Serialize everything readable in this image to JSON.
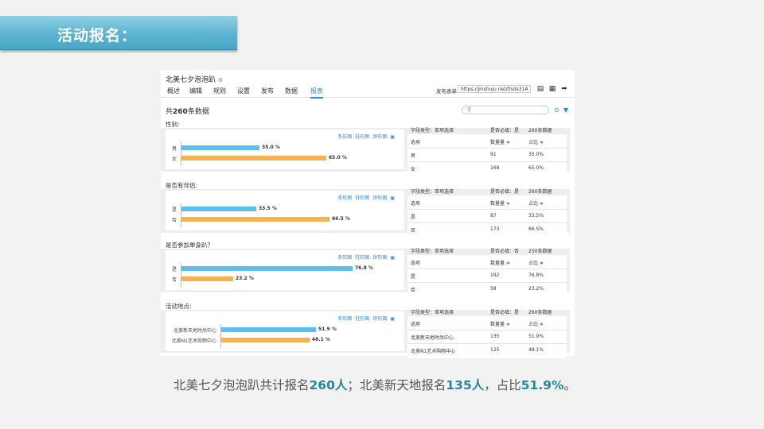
{
  "slide": {
    "banner_title": "活动报名：",
    "caption": [
      {
        "text": "北美七夕泡泡趴共计报名",
        "hl": false
      },
      {
        "text": "260人",
        "hl": true
      },
      {
        "text": "；北美新天地报名",
        "hl": false
      },
      {
        "text": "135人",
        "hl": true
      },
      {
        "text": "，占比",
        "hl": false
      },
      {
        "text": "51.9%",
        "hl": true
      },
      {
        "text": "。",
        "hl": false
      }
    ]
  },
  "app": {
    "title": "北美七夕泡泡趴",
    "tabs": [
      "概述",
      "编辑",
      "规则",
      "设置",
      "发布",
      "数据",
      "报表"
    ],
    "active_tab": "报表",
    "publish_label": "发布表单",
    "publish_url": "https://jinshuju.net/f/sds31A",
    "total_prefix": "共",
    "total_count": "260",
    "total_suffix": "条数据",
    "chart_links": [
      "条形图",
      "柱形图",
      "饼形图"
    ],
    "table_header": {
      "option": "选项",
      "count": "数量量 ≑",
      "ratio": "占比 ≑"
    },
    "accent_color": "#2a8bd8",
    "bar_colors": [
      "#5bc0ef",
      "#f7b150"
    ]
  },
  "sections": [
    {
      "title": "性别:",
      "field_type": "字段类型：单项选择",
      "required": "是否必填：是",
      "count_label": "260条数据",
      "options": [
        {
          "label": "男",
          "pct": 35.0,
          "bar_text": "35.0 %",
          "count": "91",
          "ratio": "35.0%"
        },
        {
          "label": "女",
          "pct": 65.0,
          "bar_text": "65.0 %",
          "count": "169",
          "ratio": "65.0%"
        }
      ]
    },
    {
      "title": "是否有伴侣:",
      "field_type": "字段类型：单项选择",
      "required": "是否必填：是",
      "count_label": "260条数据",
      "options": [
        {
          "label": "是",
          "pct": 33.5,
          "bar_text": "33.5 %",
          "count": "87",
          "ratio": "33.5%"
        },
        {
          "label": "否",
          "pct": 66.5,
          "bar_text": "66.5 %",
          "count": "173",
          "ratio": "66.5%"
        }
      ]
    },
    {
      "title": "是否参加单身趴？",
      "field_type": "字段类型：单项选择",
      "required": "是否必填：否",
      "count_label": "250条数据",
      "options": [
        {
          "label": "是",
          "pct": 76.8,
          "bar_text": "76.8 %",
          "count": "192",
          "ratio": "76.8%"
        },
        {
          "label": "否",
          "pct": 23.2,
          "bar_text": "23.2 %",
          "count": "58",
          "ratio": "23.2%"
        }
      ]
    },
    {
      "title": "活动地点:",
      "field_type": "字段类型：单项选择",
      "required": "是否必填：是",
      "count_label": "260条数据",
      "options": [
        {
          "label": "北美新天地时尚中心",
          "pct": 51.9,
          "bar_text": "51.9 %",
          "count": "135",
          "ratio": "51.9%"
        },
        {
          "label": "北美N1艺术购物中心",
          "pct": 48.1,
          "bar_text": "48.1 %",
          "count": "125",
          "ratio": "48.1%"
        }
      ]
    }
  ]
}
